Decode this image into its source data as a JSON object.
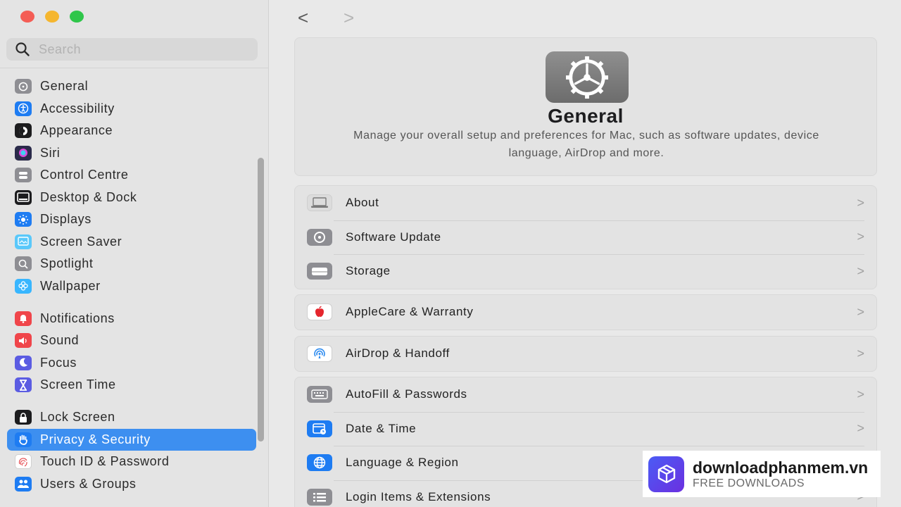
{
  "window": {
    "traffic_lights": [
      "#f45d55",
      "#f5b62f",
      "#2fc64a"
    ]
  },
  "search": {
    "placeholder": "Search"
  },
  "sidebar": {
    "groups": [
      [
        {
          "label": "General",
          "icon": "gear-icon",
          "color": "#8e8e93"
        },
        {
          "label": "Accessibility",
          "icon": "accessibility-icon",
          "color": "#1e7cf2"
        },
        {
          "label": "Appearance",
          "icon": "appearance-icon",
          "color": "#1c1c1e"
        },
        {
          "label": "Siri",
          "icon": "siri-icon",
          "color": "#2a2a4a"
        },
        {
          "label": "Control Centre",
          "icon": "control-centre-icon",
          "color": "#8e8e93"
        },
        {
          "label": "Desktop & Dock",
          "icon": "dock-icon",
          "color": "#1c1c1e"
        },
        {
          "label": "Displays",
          "icon": "sun-icon",
          "color": "#1e7cf2"
        },
        {
          "label": "Screen Saver",
          "icon": "screen-saver-icon",
          "color": "#5ac8fa"
        },
        {
          "label": "Spotlight",
          "icon": "magnifier-icon",
          "color": "#8e8e93"
        },
        {
          "label": "Wallpaper",
          "icon": "flower-icon",
          "color": "#38b6ff"
        }
      ],
      [
        {
          "label": "Notifications",
          "icon": "bell-icon",
          "color": "#f0454a"
        },
        {
          "label": "Sound",
          "icon": "speaker-icon",
          "color": "#f0454a"
        },
        {
          "label": "Focus",
          "icon": "moon-icon",
          "color": "#5b5ce2"
        },
        {
          "label": "Screen Time",
          "icon": "hourglass-icon",
          "color": "#5b5ce2"
        }
      ],
      [
        {
          "label": "Lock Screen",
          "icon": "lock-icon",
          "color": "#1c1c1e"
        },
        {
          "label": "Privacy & Security",
          "icon": "hand-icon",
          "color": "#1e7cf2",
          "active": true
        },
        {
          "label": "Touch ID & Password",
          "icon": "fingerprint-icon",
          "color": "#ffffff"
        },
        {
          "label": "Users & Groups",
          "icon": "users-icon",
          "color": "#1e7cf2"
        }
      ]
    ]
  },
  "main": {
    "back_label": "<",
    "forward_label": ">",
    "hero": {
      "title": "General",
      "description": "Manage your overall setup and preferences for Mac, such as software updates, device language, AirDrop and more."
    },
    "cards": [
      [
        {
          "label": "About",
          "icon": "laptop-icon"
        },
        {
          "label": "Software Update",
          "icon": "gear-badge-icon"
        },
        {
          "label": "Storage",
          "icon": "drive-icon"
        }
      ],
      [
        {
          "label": "AppleCare & Warranty",
          "icon": "apple-icon"
        }
      ],
      [
        {
          "label": "AirDrop & Handoff",
          "icon": "airdrop-icon"
        }
      ],
      [
        {
          "label": "AutoFill & Passwords",
          "icon": "keyboard-icon"
        },
        {
          "label": "Date & Time",
          "icon": "calendar-clock-icon"
        },
        {
          "label": "Language & Region",
          "icon": "globe-icon"
        },
        {
          "label": "Login Items & Extensions",
          "icon": "list-icon"
        }
      ]
    ],
    "chevron": ">"
  },
  "watermark": {
    "name": "downloadphanmem.vn",
    "subtitle": "FREE DOWNLOADS"
  }
}
